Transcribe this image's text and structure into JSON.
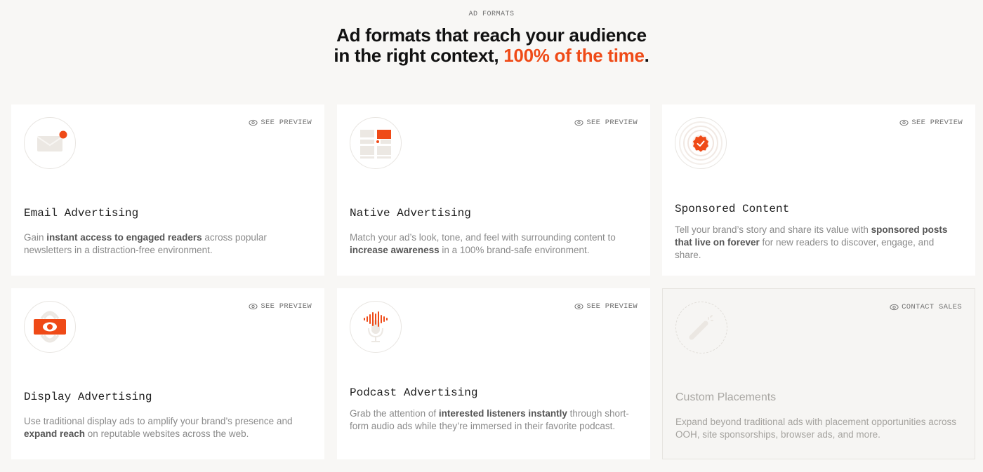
{
  "section": {
    "eyebrow": "AD FORMATS",
    "headline_line1": "Ad formats that reach your audience",
    "headline_line2_prefix": "in the right context, ",
    "headline_accent": "100% of the time",
    "headline_suffix": "."
  },
  "colors": {
    "accent": "#ef4a17",
    "muted_text": "#8a8a8a",
    "background": "#f8f7f5"
  },
  "cards": [
    {
      "icon": "envelope-notification-icon",
      "action": "SEE PREVIEW",
      "title": "Email Advertising",
      "desc": [
        "Gain ",
        "instant access to engaged readers",
        " across popular newsletters in a distraction-free environment."
      ]
    },
    {
      "icon": "native-layout-icon",
      "action": "SEE PREVIEW",
      "title": "Native Advertising",
      "desc": [
        "Match your ad’s look, tone, and feel with surrounding content to ",
        "increase awareness",
        " in a 100% brand-safe environment."
      ]
    },
    {
      "icon": "verified-badge-icon",
      "action": "SEE PREVIEW",
      "title": "Sponsored Content",
      "desc": [
        "Tell your brand’s story and share its value with ",
        "sponsored posts that live on forever",
        " for new readers to discover, engage, and share."
      ]
    },
    {
      "icon": "eye-banner-icon",
      "action": "SEE PREVIEW",
      "title": "Display Advertising",
      "desc": [
        "Use traditional display ads to amplify your brand’s presence and ",
        "expand reach",
        " on reputable websites across the web."
      ]
    },
    {
      "icon": "microphone-waveform-icon",
      "action": "SEE PREVIEW",
      "title": "Podcast Advertising",
      "desc": [
        "Grab the attention of ",
        "interested listeners instantly",
        " through short-form audio ads while they’re immersed in their favorite podcast."
      ]
    },
    {
      "icon": "magic-wand-icon",
      "action": "CONTACT SALES",
      "title": "Custom Placements",
      "desc": [
        "Expand beyond traditional ads with placement opportunities across OOH, site sponsorships, browser ads, and more.",
        "",
        ""
      ]
    }
  ]
}
